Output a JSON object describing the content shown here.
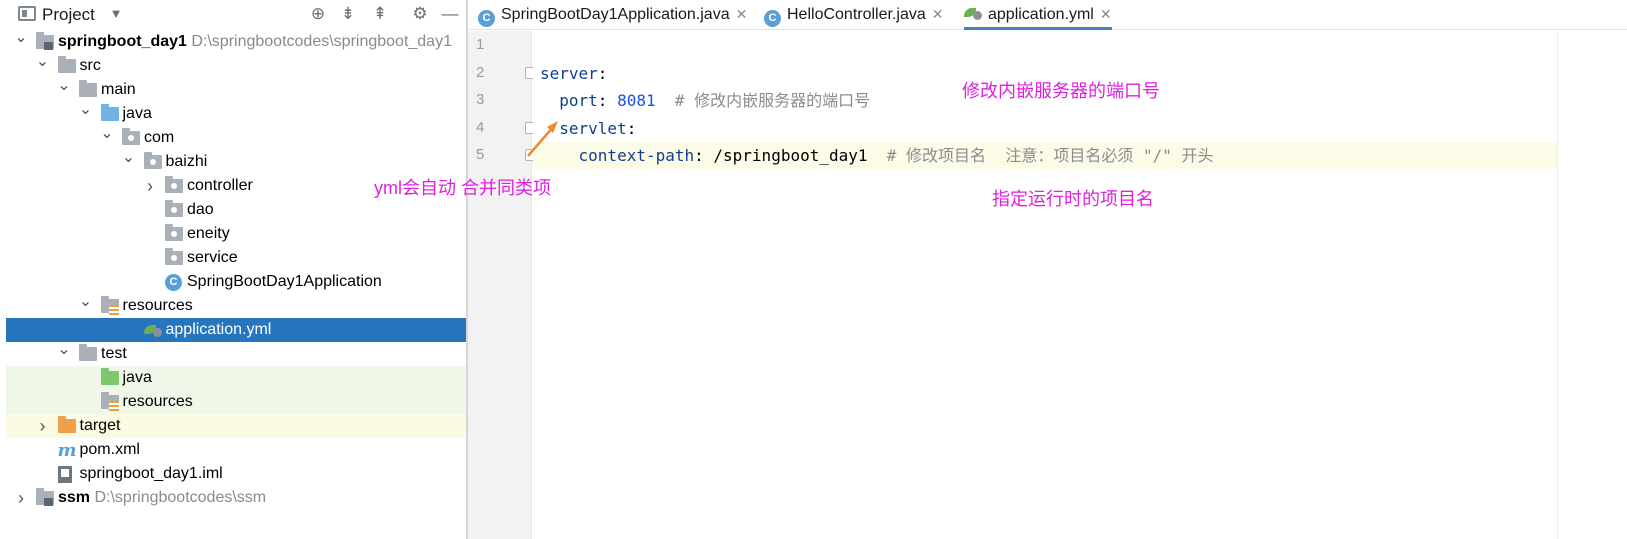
{
  "panel": {
    "title": "Project",
    "dropdown_glyph": "▼",
    "icons": [
      "locate-icon",
      "expand-all-icon",
      "collapse-all-icon",
      "gear-icon",
      "minimize-icon"
    ]
  },
  "tree": [
    {
      "name": "springboot_day1",
      "path": "D:\\springbootcodes\\springboot_day1",
      "depth": 0,
      "expanded": true,
      "icon": "module-folder-icon",
      "bold": true
    },
    {
      "name": "src",
      "depth": 1,
      "expanded": true,
      "icon": "folder-icon"
    },
    {
      "name": "main",
      "depth": 2,
      "expanded": true,
      "icon": "folder-icon"
    },
    {
      "name": "java",
      "depth": 3,
      "expanded": true,
      "icon": "source-folder-icon"
    },
    {
      "name": "com",
      "depth": 4,
      "expanded": true,
      "icon": "package-icon"
    },
    {
      "name": "baizhi",
      "depth": 5,
      "expanded": true,
      "icon": "package-icon"
    },
    {
      "name": "controller",
      "depth": 6,
      "expanded": false,
      "icon": "package-icon"
    },
    {
      "name": "dao",
      "depth": 6,
      "icon": "package-icon"
    },
    {
      "name": "eneity",
      "depth": 6,
      "icon": "package-icon"
    },
    {
      "name": "service",
      "depth": 6,
      "icon": "package-icon"
    },
    {
      "name": "SpringBootDay1Application",
      "depth": 6,
      "icon": "spring-class-icon"
    },
    {
      "name": "resources",
      "depth": 3,
      "expanded": true,
      "icon": "resources-folder-icon"
    },
    {
      "name": "application.yml",
      "depth": 5,
      "icon": "yml-file-icon",
      "selected": true
    },
    {
      "name": "test",
      "depth": 2,
      "expanded": true,
      "icon": "folder-icon"
    },
    {
      "name": "java",
      "depth": 3,
      "icon": "test-folder-icon",
      "bg": "test"
    },
    {
      "name": "resources",
      "depth": 3,
      "icon": "test-resources-folder-icon",
      "bg": "test"
    },
    {
      "name": "target",
      "depth": 1,
      "expanded": false,
      "icon": "excluded-folder-icon",
      "bg": "target"
    },
    {
      "name": "pom.xml",
      "depth": 1,
      "icon": "maven-pom-icon"
    },
    {
      "name": "springboot_day1.iml",
      "depth": 1,
      "icon": "iml-file-icon"
    },
    {
      "name": "ssm",
      "path": "D:\\springbootcodes\\ssm",
      "depth": 0,
      "expanded": false,
      "icon": "module-folder-icon",
      "bold": true
    }
  ],
  "tabs": [
    {
      "label": "SpringBootDay1Application.java",
      "icon": "spring-class-icon",
      "close": "✕"
    },
    {
      "label": "HelloController.java",
      "icon": "class-icon",
      "close": "✕"
    },
    {
      "label": "application.yml",
      "icon": "yml-file-icon",
      "close": "✕",
      "active": true
    }
  ],
  "editor": {
    "line_numbers": [
      "1",
      "2",
      "3",
      "4",
      "5"
    ],
    "lines": [
      {
        "tokens": []
      },
      {
        "tokens": [
          {
            "t": "server",
            "c": "k"
          },
          {
            "t": ":",
            "c": "v"
          }
        ]
      },
      {
        "tokens": [
          {
            "t": "  ",
            "c": "v"
          },
          {
            "t": "port",
            "c": "k"
          },
          {
            "t": ": ",
            "c": "v"
          },
          {
            "t": "8081",
            "c": "n"
          },
          {
            "t": "  # 修改内嵌服务器的端口号",
            "c": "c"
          }
        ]
      },
      {
        "tokens": [
          {
            "t": "  ",
            "c": "v"
          },
          {
            "t": "servlet",
            "c": "k"
          },
          {
            "t": ":",
            "c": "v"
          }
        ]
      },
      {
        "tokens": [
          {
            "t": "    ",
            "c": "v"
          },
          {
            "t": "context-path",
            "c": "k"
          },
          {
            "t": ": /springboot_day1",
            "c": "v"
          },
          {
            "t": "  # 修改项目名  注意：项目名必须 \"/\" 开头",
            "c": "c"
          }
        ],
        "current": true
      }
    ]
  },
  "annotations": {
    "port_note": "修改内嵌服务器的端口号",
    "merge_note": "yml会自动 合并同类项",
    "context_note": "指定运行时的项目名"
  },
  "colors": {
    "selection": "#2675bf",
    "annotation": "#e020e0",
    "arrow": "#f08a2c",
    "yaml_key": "#0f3f8c",
    "yaml_number": "#1750eb",
    "comment": "#8c8c8c"
  }
}
